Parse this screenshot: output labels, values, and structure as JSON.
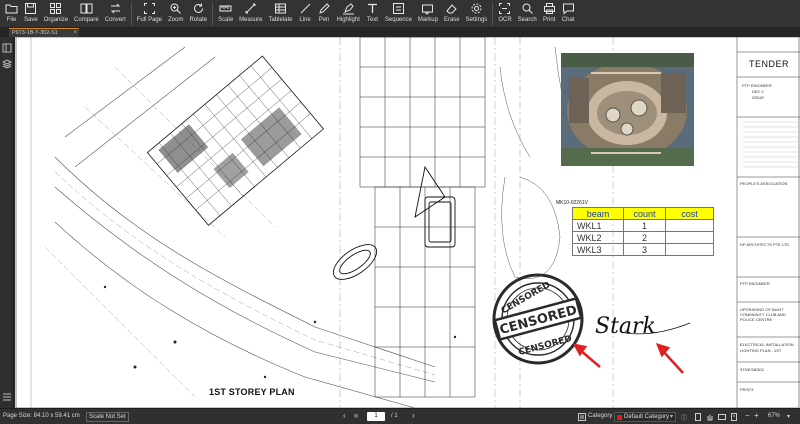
{
  "toolbar": {
    "items": [
      {
        "label": "File",
        "icon": "folder-icon"
      },
      {
        "label": "Save",
        "icon": "save-icon"
      },
      {
        "label": "Organize",
        "icon": "organize-icon"
      },
      {
        "label": "Compare",
        "icon": "compare-icon"
      },
      {
        "label": "Convert",
        "icon": "convert-icon"
      },
      {
        "label": "Full Page",
        "icon": "full-page-icon"
      },
      {
        "label": "Zoom",
        "icon": "zoom-icon"
      },
      {
        "label": "Rotate",
        "icon": "rotate-icon"
      },
      {
        "label": "Scale",
        "icon": "scale-icon"
      },
      {
        "label": "Measure",
        "icon": "measure-icon"
      },
      {
        "label": "Tablelate",
        "icon": "table-icon"
      },
      {
        "label": "Line",
        "icon": "line-icon"
      },
      {
        "label": "Pen",
        "icon": "pen-icon"
      },
      {
        "label": "Highlight",
        "icon": "highlight-icon"
      },
      {
        "label": "Text",
        "icon": "text-icon"
      },
      {
        "label": "Sequence",
        "icon": "sequence-icon"
      },
      {
        "label": "Markup",
        "icon": "markup-icon"
      },
      {
        "label": "Erase",
        "icon": "erase-icon"
      },
      {
        "label": "Settings",
        "icon": "gear-icon"
      },
      {
        "label": "OCR",
        "icon": "ocr-icon"
      },
      {
        "label": "Search",
        "icon": "search-icon"
      },
      {
        "label": "Print",
        "icon": "print-icon"
      },
      {
        "label": "Chat",
        "icon": "chat-icon"
      }
    ]
  },
  "tab": {
    "label": "P973-1B-T-302-S1",
    "close": "×"
  },
  "drawing": {
    "plan_title": "1ST STOREY PLAN",
    "tender": "TENDER",
    "stamp_word": "CENSORED",
    "signature": "Stark",
    "grid_label": "MK10-02261V",
    "table": {
      "headers": [
        "beam",
        "count",
        "cost"
      ],
      "rows": [
        {
          "beam": "WKL1",
          "count": "1",
          "cost": ""
        },
        {
          "beam": "WKL2",
          "count": "2",
          "cost": ""
        },
        {
          "beam": "WKL3",
          "count": "3",
          "cost": ""
        }
      ]
    },
    "title_block": [
      "PTP ENGINEER",
      "DEC 2",
      "ISSUE",
      "PEOPLE'S ASSOCIATION",
      "DP ARCHITECTS PTE LTD",
      "PTP ENGINEER",
      "UPGRADING OF BUKIT",
      "COMMUNITY CLUB AND",
      "POLICE CENTRE",
      "ELECTRICAL INSTALLATION",
      "LIGHTING PLAN - 1ST",
      "973/E/08/302",
      "PR/973"
    ]
  },
  "status": {
    "page_size": "Page Size: 84.10 x 59.41 cm",
    "scale": "Scale Not Set",
    "current_page": "1",
    "total_pages": "/ 1",
    "category_label": "Category",
    "category_value": "Default Category",
    "zoom": "67%"
  },
  "colors": {
    "accent": "#d08a2b",
    "markup_red": "#e02020",
    "table_header": "#ffff00"
  }
}
